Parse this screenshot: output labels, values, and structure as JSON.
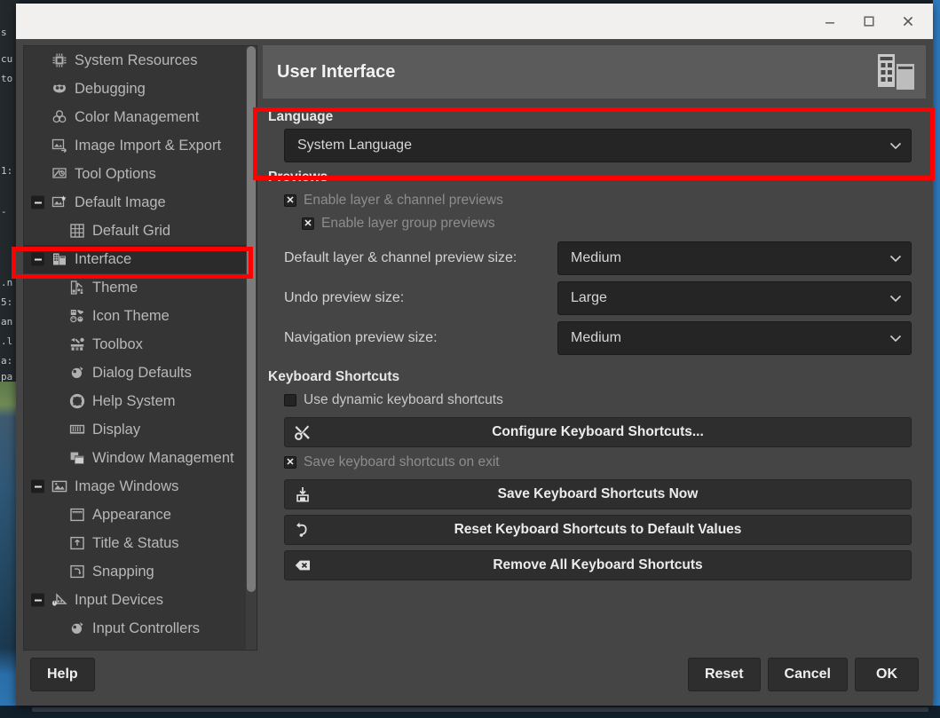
{
  "window": {
    "controls": [
      {
        "name": "minimize",
        "glyph": "minimize-icon"
      },
      {
        "name": "maximize",
        "glyph": "maximize-icon"
      },
      {
        "name": "close",
        "glyph": "close-icon"
      }
    ]
  },
  "sidebar": {
    "items": [
      {
        "label": "System Resources",
        "icon": "cpu-icon",
        "indent": 0,
        "expander": false,
        "selected": false
      },
      {
        "label": "Debugging",
        "icon": "wilber-icon",
        "indent": 0,
        "expander": false,
        "selected": false
      },
      {
        "label": "Color Management",
        "icon": "color-circles-icon",
        "indent": 0,
        "expander": false,
        "selected": false
      },
      {
        "label": "Image Import & Export",
        "icon": "import-export-icon",
        "indent": 0,
        "expander": false,
        "selected": false
      },
      {
        "label": "Tool Options",
        "icon": "tool-options-icon",
        "indent": 0,
        "expander": false,
        "selected": false
      },
      {
        "label": "Default Image",
        "icon": "default-image-icon",
        "indent": 0,
        "expander": true,
        "selected": false
      },
      {
        "label": "Default Grid",
        "icon": "grid-icon",
        "indent": 1,
        "expander": false,
        "selected": false
      },
      {
        "label": "Interface",
        "icon": "interface-icon",
        "indent": 0,
        "expander": true,
        "selected": true
      },
      {
        "label": "Theme",
        "icon": "theme-icon",
        "indent": 1,
        "expander": false,
        "selected": false
      },
      {
        "label": "Icon Theme",
        "icon": "icon-theme-icon",
        "indent": 1,
        "expander": false,
        "selected": false
      },
      {
        "label": "Toolbox",
        "icon": "toolbox-icon",
        "indent": 1,
        "expander": false,
        "selected": false
      },
      {
        "label": "Dialog Defaults",
        "icon": "dialog-defaults-icon",
        "indent": 1,
        "expander": false,
        "selected": false
      },
      {
        "label": "Help System",
        "icon": "help-system-icon",
        "indent": 1,
        "expander": false,
        "selected": false
      },
      {
        "label": "Display",
        "icon": "display-icon",
        "indent": 1,
        "expander": false,
        "selected": false
      },
      {
        "label": "Window Management",
        "icon": "window-management-icon",
        "indent": 1,
        "expander": false,
        "selected": false
      },
      {
        "label": "Image Windows",
        "icon": "image-windows-icon",
        "indent": 0,
        "expander": true,
        "selected": false
      },
      {
        "label": "Appearance",
        "icon": "appearance-icon",
        "indent": 1,
        "expander": false,
        "selected": false
      },
      {
        "label": "Title & Status",
        "icon": "title-status-icon",
        "indent": 1,
        "expander": false,
        "selected": false
      },
      {
        "label": "Snapping",
        "icon": "snapping-icon",
        "indent": 1,
        "expander": false,
        "selected": false
      },
      {
        "label": "Input Devices",
        "icon": "input-devices-icon",
        "indent": 0,
        "expander": true,
        "selected": false
      },
      {
        "label": "Input Controllers",
        "icon": "input-controllers-icon",
        "indent": 1,
        "expander": false,
        "selected": false
      }
    ]
  },
  "page": {
    "title": "User Interface",
    "header_icon": "user-interface-icon"
  },
  "language": {
    "section_title": "Language",
    "selected": "System Language",
    "chevron": "⌄"
  },
  "previews": {
    "section_title": "Previews",
    "checkboxes": [
      {
        "label": "Enable layer & channel previews",
        "checked": true,
        "indent": 0,
        "dim": true,
        "mark": "✕"
      },
      {
        "label": "Enable layer group previews",
        "checked": true,
        "indent": 1,
        "dim": true,
        "mark": "✕"
      }
    ],
    "fields": [
      {
        "label": "Default layer & channel preview size:",
        "value": "Medium"
      },
      {
        "label": "Undo preview size:",
        "value": "Large"
      },
      {
        "label": "Navigation preview size:",
        "value": "Medium"
      }
    ]
  },
  "shortcuts": {
    "section_title": "Keyboard Shortcuts",
    "use_dynamic": {
      "label": "Use dynamic keyboard shortcuts",
      "checked": false,
      "mark": ""
    },
    "configure_button": {
      "label": "Configure Keyboard Shortcuts...",
      "icon": "tools-icon"
    },
    "save_on_exit": {
      "label": "Save keyboard shortcuts on exit",
      "checked": true,
      "mark": "✕"
    },
    "buttons": [
      {
        "label": "Save Keyboard Shortcuts Now",
        "icon": "save-icon"
      },
      {
        "label": "Reset Keyboard Shortcuts to Default Values",
        "icon": "reset-icon"
      },
      {
        "label": "Remove All Keyboard Shortcuts",
        "icon": "delete-icon"
      }
    ]
  },
  "footer": {
    "help": "Help",
    "reset": "Reset",
    "cancel": "Cancel",
    "ok": "OK"
  },
  "annotations": {
    "highlight_color": "#ff0000",
    "boxes": [
      {
        "target": "language-section"
      },
      {
        "target": "sidebar-item-interface"
      }
    ]
  },
  "backdrop": {
    "terminal_lines": [
      "s",
      "cu",
      "to",
      "1:",
      "-",
      ".n",
      "5:",
      "an",
      ".l",
      "a:",
      "pa"
    ]
  }
}
